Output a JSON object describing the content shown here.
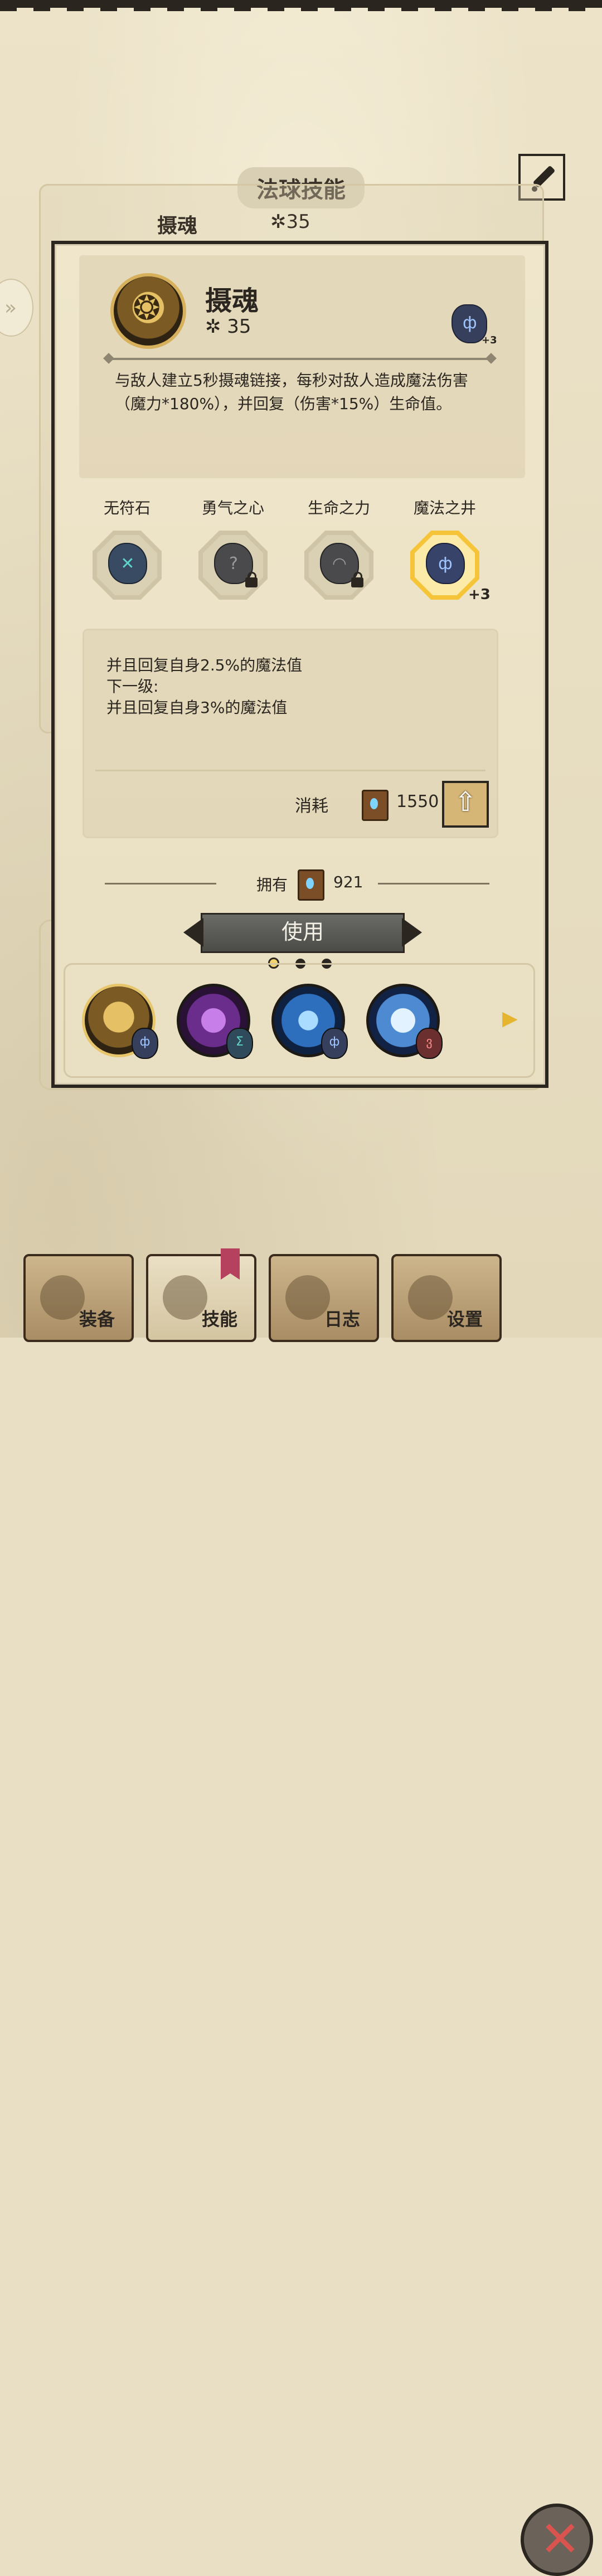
{
  "background": {
    "title": "法球技能",
    "row": {
      "name": "摄魂",
      "level": "35"
    }
  },
  "skill": {
    "name": "摄魂",
    "level": "35",
    "equipped_rune_bonus": "+3",
    "description": "与敌人建立5秒摄魂链接，每秒对敌人造成魔法伤害（魔力*180%），并回复（伤害*15%）生命值。"
  },
  "runes": [
    {
      "label": "无符石",
      "glyph": "✕",
      "locked": false,
      "selected": false
    },
    {
      "label": "勇气之心",
      "glyph": "?",
      "locked": true,
      "selected": false
    },
    {
      "label": "生命之力",
      "glyph": "◠",
      "locked": true,
      "selected": false
    },
    {
      "label": "魔法之井",
      "glyph": "ф",
      "locked": false,
      "selected": true,
      "bonus": "+3"
    }
  ],
  "rune_info": {
    "line1": "并且回复自身2.5%的魔法值",
    "line2": "下一级:",
    "line3": "并且回复自身3%的魔法值"
  },
  "upgrade": {
    "cost_label": "消耗",
    "cost_value": "1550"
  },
  "owned": {
    "label": "拥有",
    "value": "921"
  },
  "use_button": "使用",
  "page_dots": {
    "count": 3,
    "active": 0
  },
  "skill_strip": [
    {
      "name": "摄魂",
      "rune": "ф"
    },
    {
      "name": "skill-2",
      "rune": "Σ"
    },
    {
      "name": "skill-3",
      "rune": "ф"
    },
    {
      "name": "skill-4",
      "rune": "ვ"
    }
  ],
  "nav": [
    {
      "label": "装备"
    },
    {
      "label": "技能"
    },
    {
      "label": "日志"
    },
    {
      "label": "设置"
    }
  ],
  "colors": {
    "accent_gold": "#f6c439",
    "ink": "#2b2620",
    "parchment": "#efe6cc",
    "close_red": "#d9534f"
  },
  "icons": [
    "edit-icon",
    "upgrade-arrow-icon",
    "book-icon",
    "close-icon",
    "chevron-right-icon",
    "lock-icon"
  ]
}
